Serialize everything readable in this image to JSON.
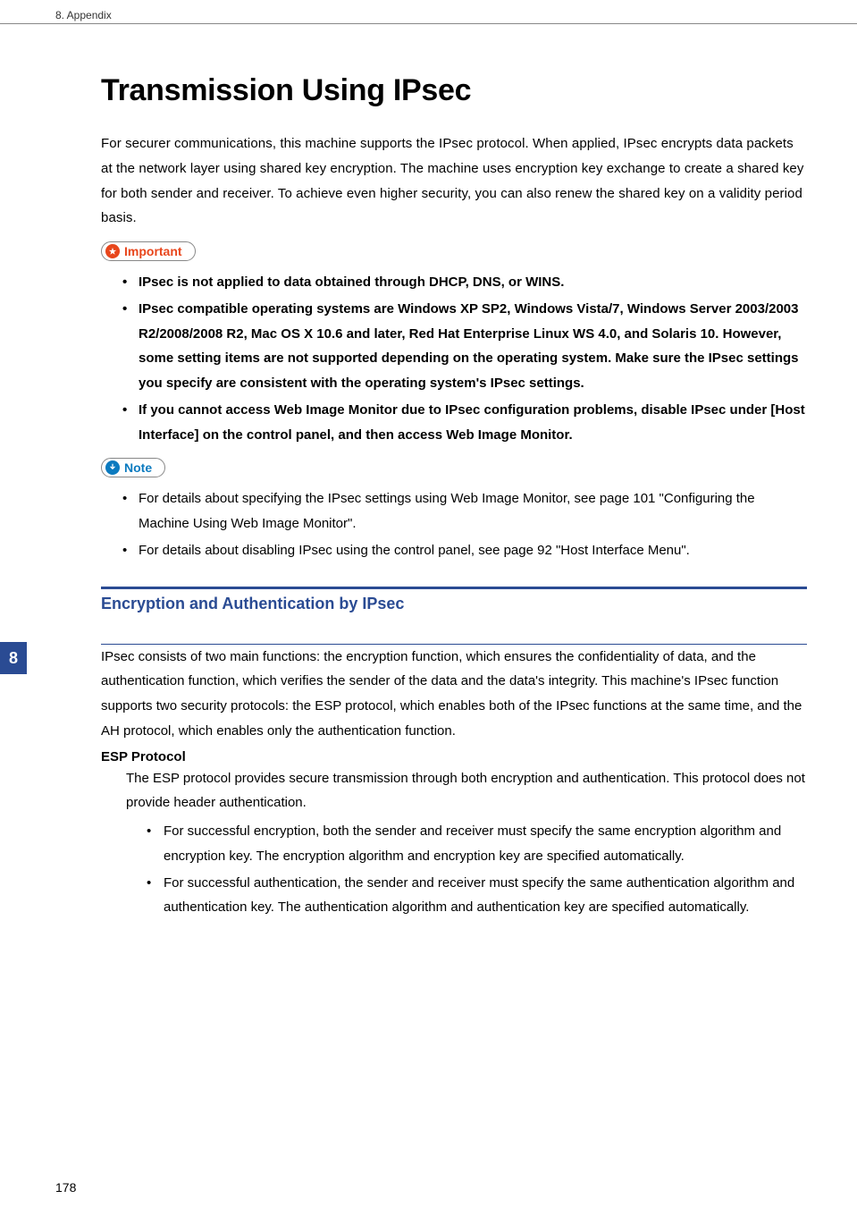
{
  "header": {
    "chapter": "8. Appendix"
  },
  "sideTab": "8",
  "pageNumber": "178",
  "title": "Transmission Using IPsec",
  "intro": "For securer communications, this machine supports the IPsec protocol. When applied, IPsec encrypts data packets at the network layer using shared key encryption. The machine uses encryption key exchange to create a shared key for both sender and receiver. To achieve even higher security, you can also renew the shared key on a validity period basis.",
  "importantLabel": "Important",
  "importantItems": [
    "IPsec is not applied to data obtained through DHCP, DNS, or WINS.",
    "IPsec compatible operating systems are Windows XP SP2, Windows Vista/7, Windows Server 2003/2003 R2/2008/2008 R2, Mac OS X 10.6 and later, Red Hat Enterprise Linux WS 4.0, and Solaris 10. However, some setting items are not supported depending on the operating system. Make sure the IPsec settings you specify are consistent with the operating system's IPsec settings.",
    "If you cannot access Web Image Monitor due to IPsec configuration problems, disable IPsec under [Host Interface] on the control panel, and then access Web Image Monitor."
  ],
  "noteLabel": "Note",
  "noteItems": [
    "For details about specifying the IPsec settings using Web Image Monitor, see page 101 \"Configuring the Machine Using Web Image Monitor\".",
    "For details about disabling IPsec using the control panel, see page 92 \"Host Interface Menu\"."
  ],
  "section": {
    "heading": "Encryption and Authentication by IPsec",
    "body": "IPsec consists of two main functions: the encryption function, which ensures the confidentiality of data, and the authentication function, which verifies the sender of the data and the data's integrity. This machine's IPsec function supports two security protocols: the ESP protocol, which enables both of the IPsec functions at the same time, and the AH protocol, which enables only the authentication function.",
    "esp": {
      "title": "ESP Protocol",
      "desc": "The ESP protocol provides secure transmission through both encryption and authentication. This protocol does not provide header authentication.",
      "items": [
        "For successful encryption, both the sender and receiver must specify the same encryption algorithm and encryption key. The encryption algorithm and encryption key are specified automatically.",
        "For successful authentication, the sender and receiver must specify the same authentication algorithm and authentication key. The authentication algorithm and authentication key are specified automatically."
      ]
    }
  }
}
